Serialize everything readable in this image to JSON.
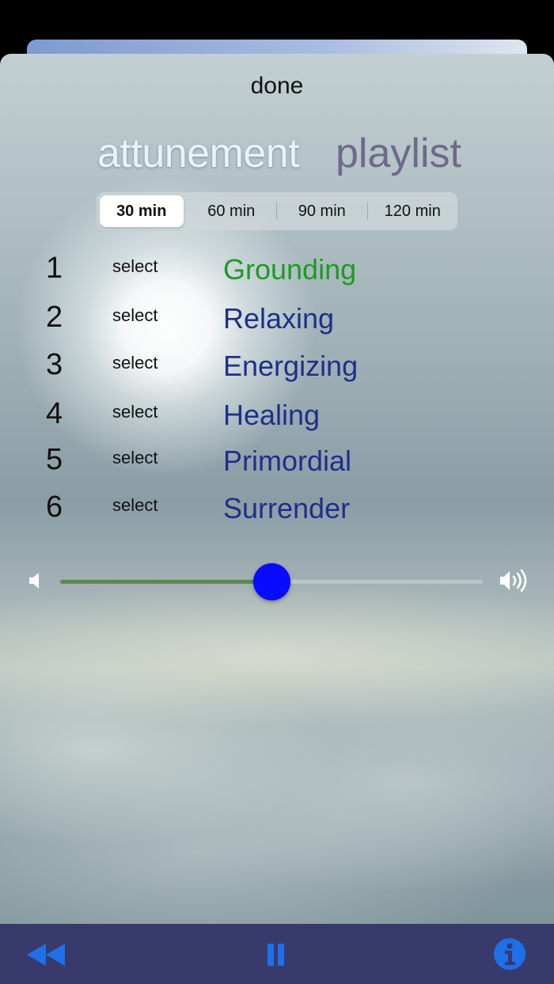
{
  "header": {
    "done_label": "done"
  },
  "title": {
    "attunement": "attunement",
    "playlist": "playlist"
  },
  "durations": [
    {
      "label": "30 min",
      "selected": true
    },
    {
      "label": "60 min",
      "selected": false
    },
    {
      "label": "90 min",
      "selected": false
    },
    {
      "label": "120 min",
      "selected": false
    }
  ],
  "tracks": [
    {
      "number": "1",
      "select_label": "select",
      "name": "Grounding",
      "active": true
    },
    {
      "number": "2",
      "select_label": "select",
      "name": "Relaxing",
      "active": false
    },
    {
      "number": "3",
      "select_label": "select",
      "name": "Energizing",
      "active": false
    },
    {
      "number": "4",
      "select_label": "select",
      "name": "Healing",
      "active": false
    },
    {
      "number": "5",
      "select_label": "select",
      "name": "Primordial",
      "active": false
    },
    {
      "number": "6",
      "select_label": "select",
      "name": "Surrender",
      "active": false
    }
  ],
  "volume": {
    "level": 0.5,
    "low_icon": "speaker-low-icon",
    "high_icon": "speaker-high-icon"
  },
  "controls": {
    "rewind_icon": "rewind-icon",
    "pause_icon": "pause-icon",
    "info_icon": "info-icon"
  },
  "colors": {
    "active_track": "#1e9a24",
    "track": "#1f2f8a",
    "slider_thumb": "#0a0aff",
    "slider_fill": "#5b8a4a",
    "bottom_bar": "#383a6c",
    "control_blue": "#1f6fe8"
  }
}
